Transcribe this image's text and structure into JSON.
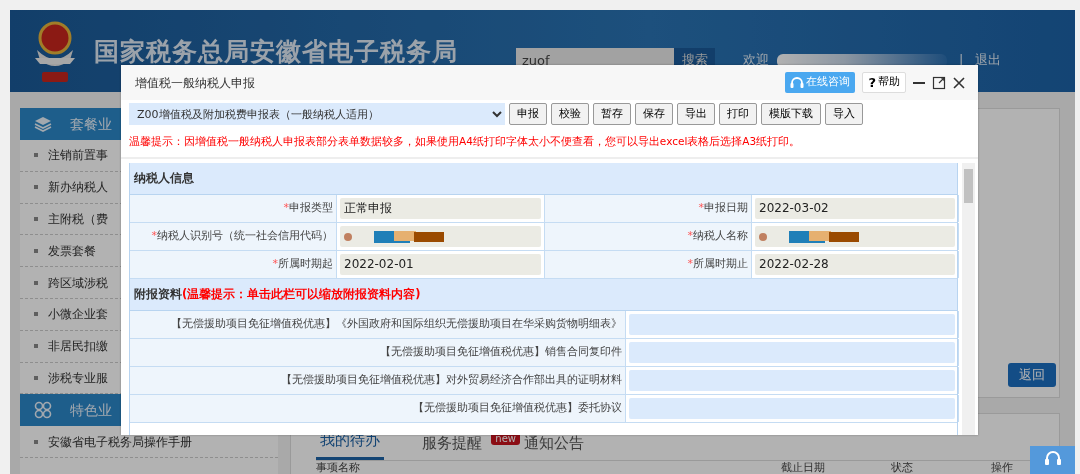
{
  "header": {
    "title": "国家税务总局安徽省电子税务局",
    "search": {
      "value": "zuof",
      "button": "搜索"
    },
    "welcome": "欢迎",
    "separator": "|",
    "logout": "退出"
  },
  "sidebar": {
    "groups": [
      {
        "title": "套餐业",
        "items": [
          "注销前置事",
          "新办纳税人",
          "主附税（费",
          "发票套餐",
          "跨区域涉税",
          "小微企业套",
          "非居民扣缴",
          "涉税专业服"
        ]
      },
      {
        "title": "特色业",
        "items": [
          "安徽省电子税务局操作手册"
        ]
      }
    ]
  },
  "main": {
    "back_button": "返回",
    "tabs": [
      {
        "label": "我的待办",
        "selected": true
      },
      {
        "label": "服务提醒",
        "selected": false,
        "badge": "new"
      },
      {
        "label": "通知公告",
        "selected": false
      }
    ],
    "table": {
      "columns": [
        "事项名称",
        "截止日期",
        "状态",
        "操作"
      ]
    }
  },
  "modal": {
    "title": "增值税一般纳税人申报",
    "consult_button": "在线咨询",
    "help_button": {
      "icon": "?",
      "label": "帮助"
    },
    "form_select": "Z00增值税及附加税费申报表（一般纳税人适用）",
    "actions": [
      "申报",
      "校验",
      "暂存",
      "保存",
      "导出",
      "打印",
      "模版下载",
      "导入"
    ],
    "notice": "温馨提示：因增值税一般纳税人申报表部分表单数据较多，如果使用A4纸打印字体太小不便查看，您可以导出excel表格后选择A3纸打印。",
    "taxpayer_section": {
      "title": "纳税人信息",
      "fields": [
        {
          "label": "申报类型",
          "required_mark": "*",
          "value": "正常申报",
          "redacted": false
        },
        {
          "label": "申报日期",
          "required_mark": "*",
          "value": "2022-03-02",
          "redacted": false
        },
        {
          "label": "纳税人识别号（统一社会信用代码）",
          "required_mark": "*",
          "redacted": true
        },
        {
          "label": "纳税人名称",
          "required_mark": "*",
          "redacted": true
        },
        {
          "label": "所属时期起",
          "required_mark": "*",
          "value": "2022-02-01",
          "redacted": false
        },
        {
          "label": "所属时期止",
          "required_mark": "*",
          "value": "2022-02-28",
          "redacted": false
        }
      ]
    },
    "attachment_section": {
      "title": "附报资料",
      "hint": "(温馨提示：单击此栏可以缩放附报资料内容)",
      "items": [
        "【无偿援助项目免征增值税优惠】《外国政府和国际组织无偿援助项目在华采购货物明细表》",
        "【无偿援助项目免征增值税优惠】销售合同复印件",
        "【无偿援助项目免征增值税优惠】对外贸易经济合作部出具的证明材料",
        "【无偿援助项目免征增值税优惠】委托协议"
      ]
    }
  }
}
